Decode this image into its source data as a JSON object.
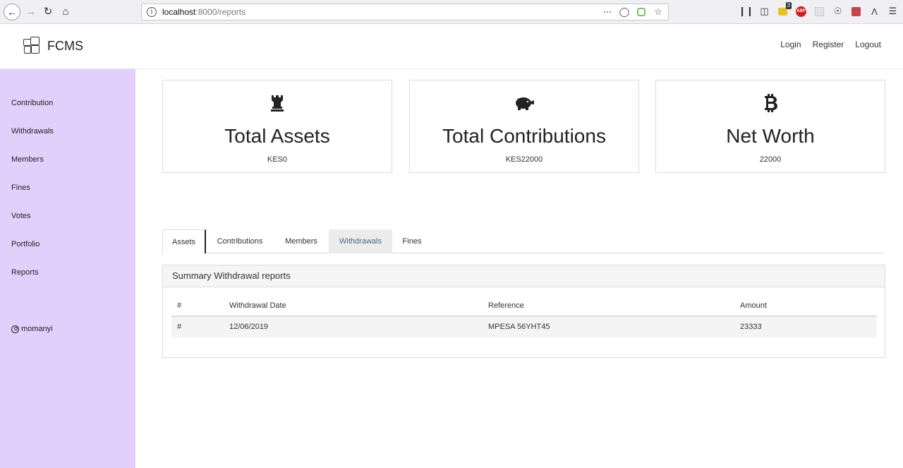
{
  "browser": {
    "url_host": "localhost",
    "url_path": ":8000/reports",
    "tab_count_badge": "3",
    "abp_label": "ABP"
  },
  "header": {
    "brand": "FCMS",
    "links": [
      "Login",
      "Register",
      "Logout"
    ]
  },
  "sidebar": {
    "items": [
      "Contribution",
      "Withdrawals",
      "Members",
      "Fines",
      "Votes",
      "Portfolio",
      "Reports"
    ],
    "user": "momanyi"
  },
  "cards": [
    {
      "icon": "chess-rook-icon",
      "title": "Total Assets",
      "value": "KES0"
    },
    {
      "icon": "piggy-bank-icon",
      "title": "Total Contributions",
      "value": "KES22000"
    },
    {
      "icon": "bitcoin-icon",
      "title": "Net Worth",
      "value": "22000"
    }
  ],
  "tabs": [
    {
      "label": "Assets",
      "state": "active"
    },
    {
      "label": "Contributions",
      "state": "normal"
    },
    {
      "label": "Members",
      "state": "normal"
    },
    {
      "label": "Withdrawals",
      "state": "hover"
    },
    {
      "label": "Fines",
      "state": "normal"
    }
  ],
  "panel": {
    "title": "Summary Withdrawal reports",
    "columns": [
      "#",
      "Withdrawal Date",
      "Reference",
      "Amount"
    ],
    "rows": [
      [
        "#",
        "12/06/2019",
        "MPESA 56YHT45",
        "23333"
      ]
    ]
  },
  "colors": {
    "sidebar_bg": "#e3cffb",
    "tab_hover_text": "#4a6a8a"
  }
}
